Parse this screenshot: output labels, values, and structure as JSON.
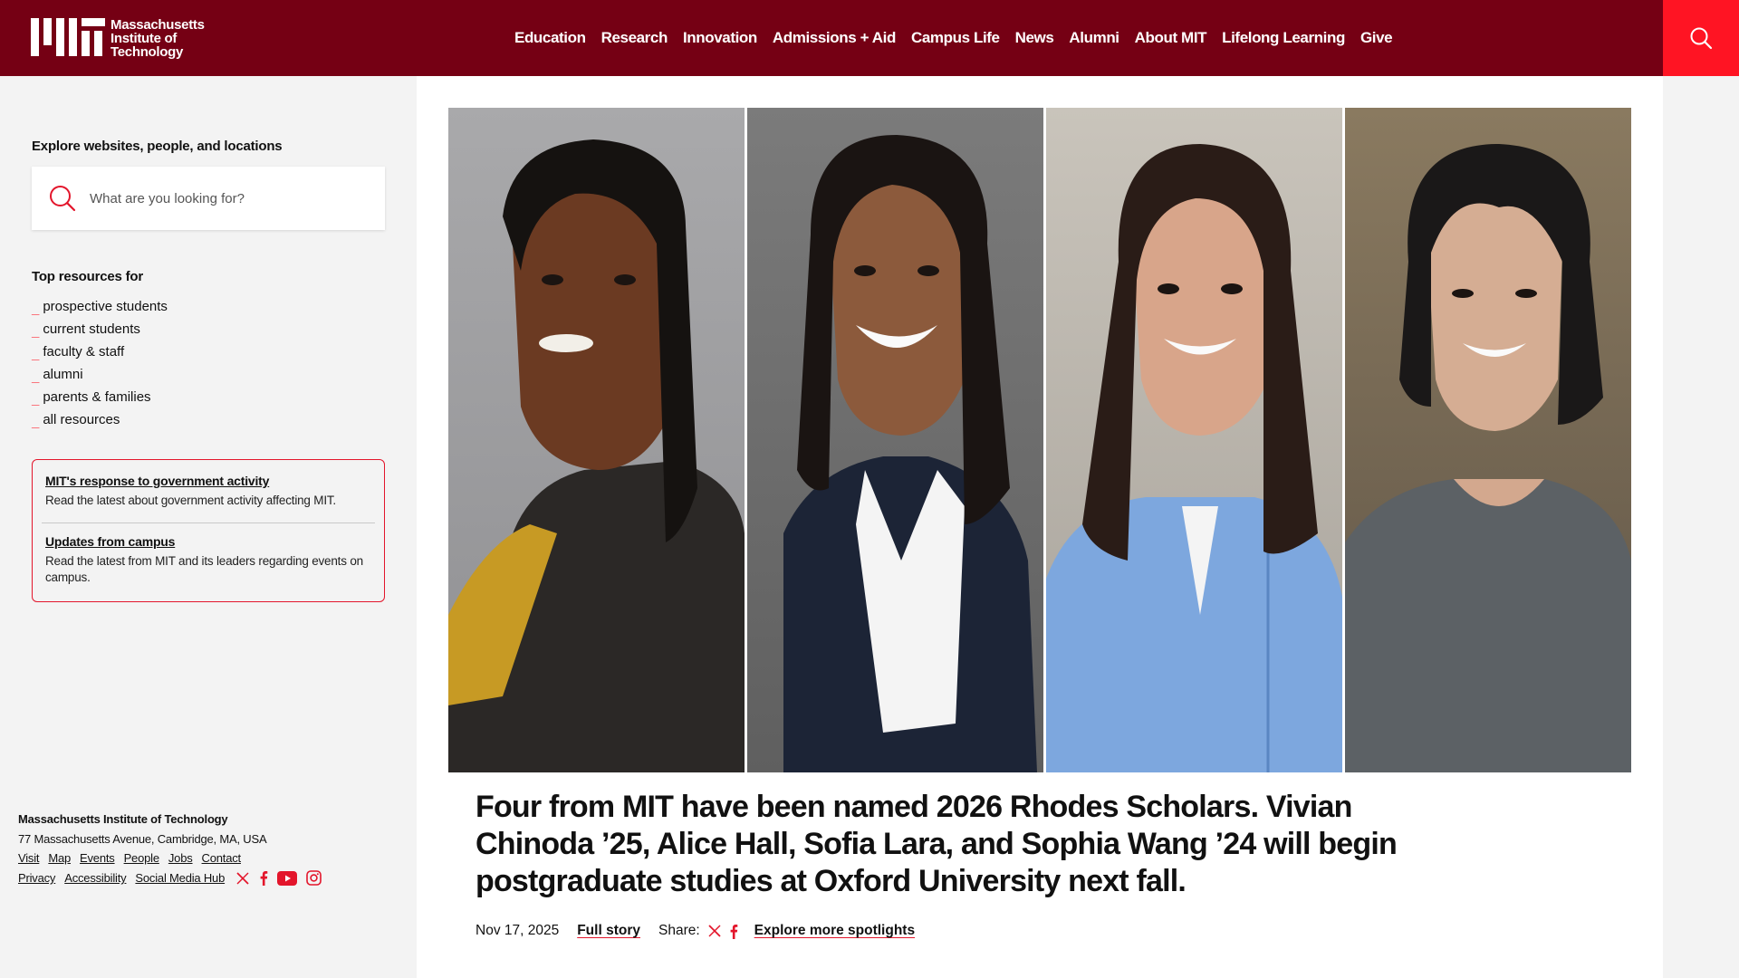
{
  "header": {
    "logo_text": [
      "Massachusetts",
      "Institute of",
      "Technology"
    ],
    "nav": [
      "Education",
      "Research",
      "Innovation",
      "Admissions + Aid",
      "Campus Life",
      "News",
      "Alumni",
      "About MIT",
      "Lifelong Learning",
      "Give"
    ],
    "colors": {
      "brand": "#750014",
      "accent": "#ff1423"
    }
  },
  "sidebar": {
    "explore_title": "Explore websites, people, and locations",
    "search_placeholder": "What are you looking for?",
    "top_resources_title": "Top resources for",
    "resources": [
      "prospective students",
      "current students",
      "faculty & staff",
      "alumni",
      "parents & families",
      "all resources"
    ],
    "notices": [
      {
        "title": "MIT's response to government activity",
        "desc": "Read the latest about government activity affecting MIT."
      },
      {
        "title": "Updates from campus",
        "desc": "Read the latest from MIT and its leaders regarding events on campus."
      }
    ]
  },
  "footer": {
    "org": "Massachusetts Institute of Technology",
    "address": "77 Massachusetts Avenue, Cambridge, MA, USA",
    "links_row1": [
      "Visit",
      "Map",
      "Events",
      "People",
      "Jobs",
      "Contact"
    ],
    "links_row2": [
      "Privacy",
      "Accessibility",
      "Social Media Hub"
    ],
    "social_icons": [
      "x-icon",
      "facebook-icon",
      "youtube-icon",
      "instagram-icon"
    ]
  },
  "spotlight": {
    "headline": "Four from MIT have been named 2026 Rhodes Scholars. Vivian Chinoda ’25, Alice Hall, Sofia Lara, and Sophia Wang ’24 will begin postgraduate studies at Oxford University next fall.",
    "date": "Nov 17, 2025",
    "full_story": "Full story",
    "share_label": "Share:",
    "explore_more": "Explore more spotlights"
  }
}
